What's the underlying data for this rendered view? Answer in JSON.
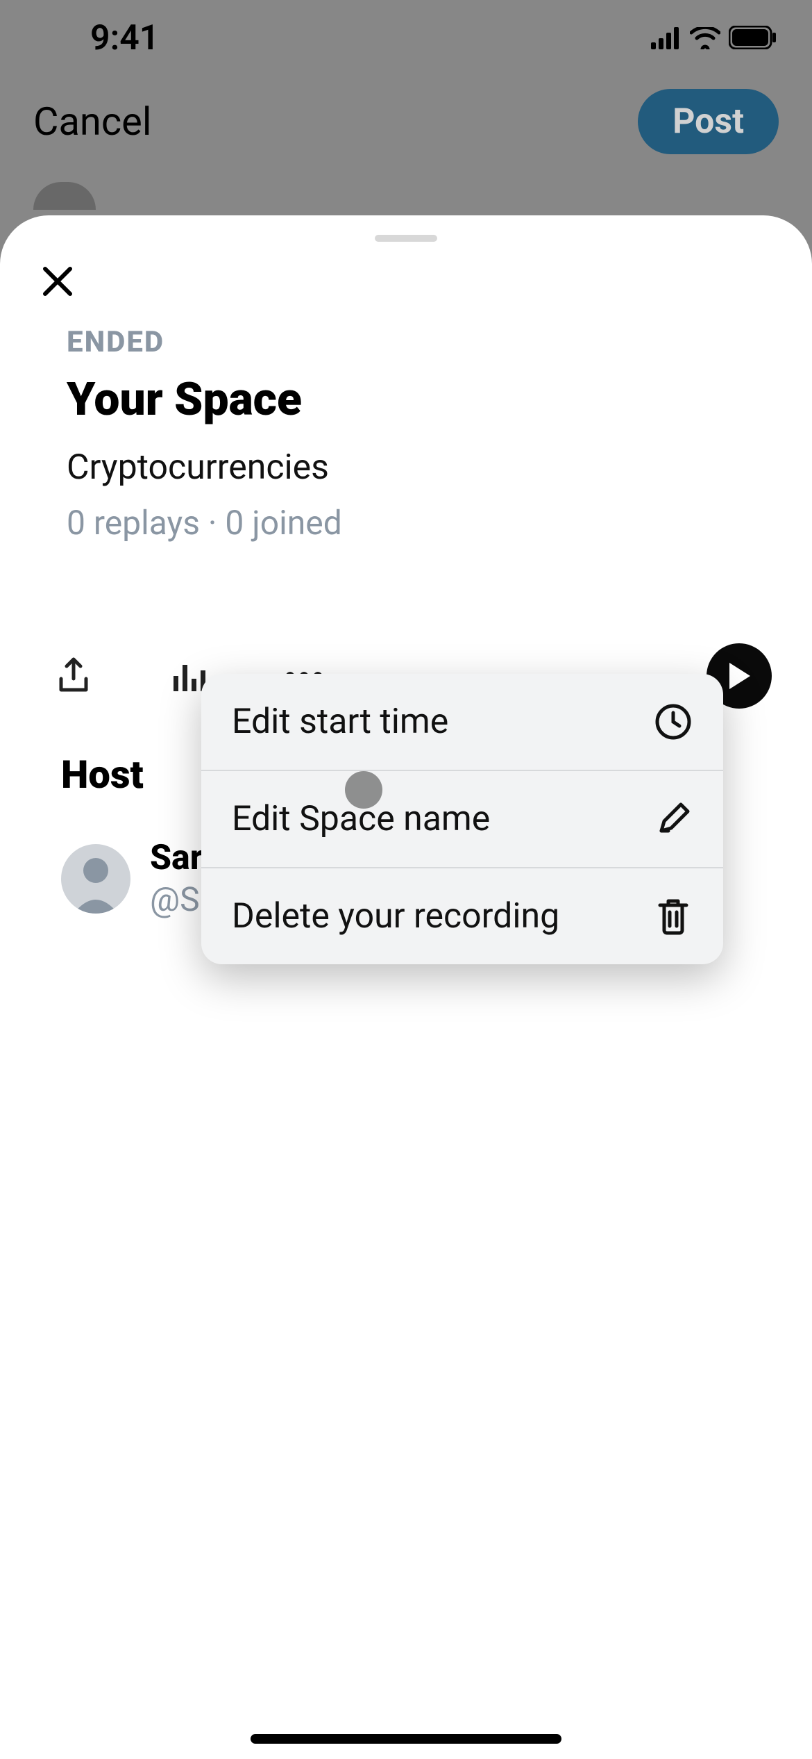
{
  "status_bar": {
    "time": "9:41"
  },
  "compose": {
    "cancel": "Cancel",
    "post": "Post"
  },
  "sheet": {
    "status": "ENDED",
    "title": "Your Space",
    "topic": "Cryptocurrencies",
    "stats": "0 replays · 0 joined",
    "host_label": "Host",
    "host": {
      "name": "Sarah",
      "handle": "@Sara"
    }
  },
  "menu": {
    "items": [
      {
        "label": "Edit start time"
      },
      {
        "label": "Edit Space name"
      },
      {
        "label": "Delete your recording"
      }
    ]
  }
}
